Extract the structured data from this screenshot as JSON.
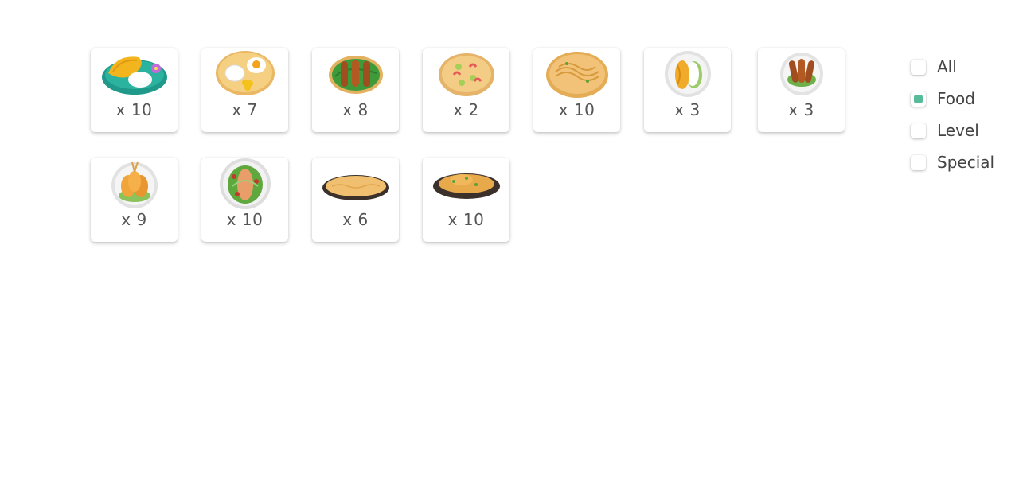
{
  "items": [
    {
      "icon": "mango-sticky-rice-icon",
      "quantity": "x 10"
    },
    {
      "icon": "rice-with-fried-egg-icon",
      "quantity": "x 7"
    },
    {
      "icon": "grilled-sausages-on-leaf-icon",
      "quantity": "x 8"
    },
    {
      "icon": "shrimp-soup-bowl-icon",
      "quantity": "x 2"
    },
    {
      "icon": "noodle-plate-icon",
      "quantity": "x 10"
    },
    {
      "icon": "mango-and-rice-plate-icon",
      "quantity": "x 3"
    },
    {
      "icon": "sausage-plate-icon",
      "quantity": "x 3"
    },
    {
      "icon": "fried-dumplings-plate-icon",
      "quantity": "x 9"
    },
    {
      "icon": "salad-plate-icon",
      "quantity": "x 10"
    },
    {
      "icon": "omelette-pan-icon",
      "quantity": "x 6"
    },
    {
      "icon": "stir-fry-pan-icon",
      "quantity": "x 10"
    }
  ],
  "filters": [
    {
      "label": "All",
      "checked": false
    },
    {
      "label": "Food",
      "checked": true
    },
    {
      "label": "Level",
      "checked": false
    },
    {
      "label": "Special",
      "checked": false
    }
  ],
  "colors": {
    "checked": "#57bb99",
    "text": "#444444"
  }
}
